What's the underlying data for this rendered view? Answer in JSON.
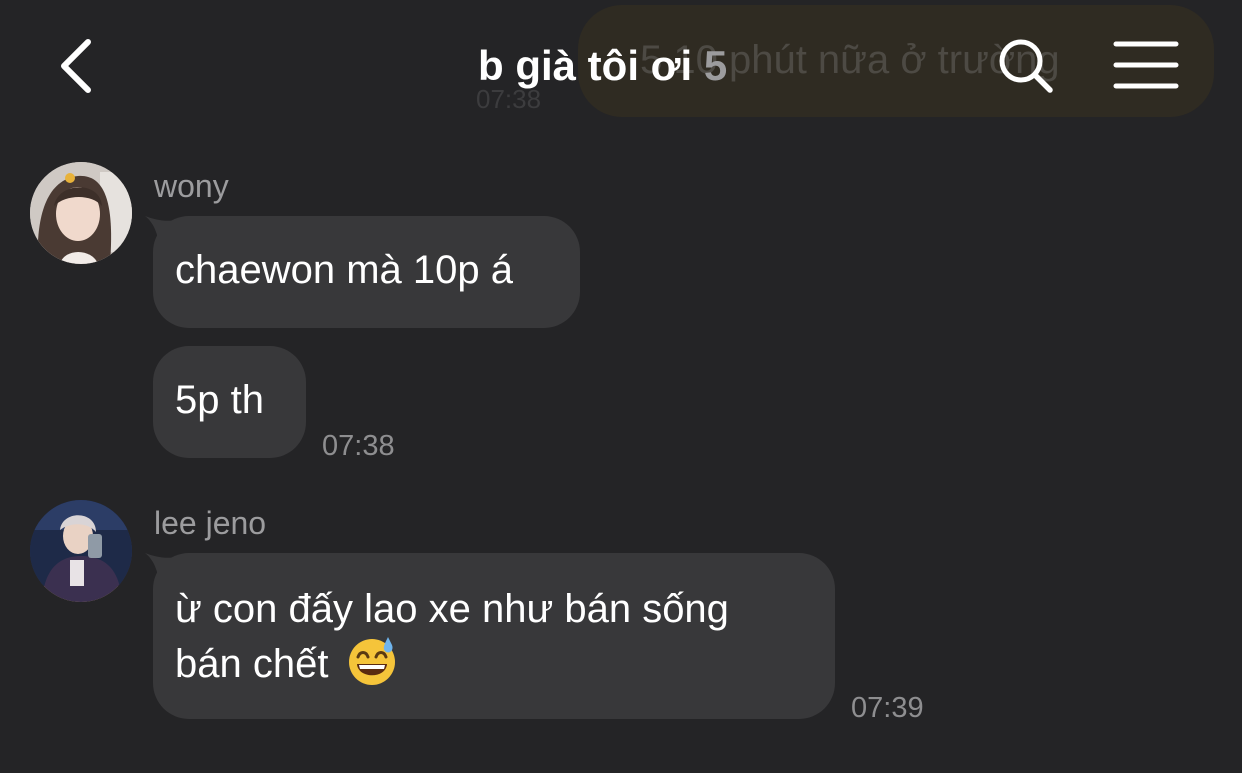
{
  "header": {
    "title": "b già tôi ơi",
    "member_count": "5",
    "back_icon": "chevron-left-icon",
    "search_icon": "search-icon",
    "menu_icon": "hamburger-menu-icon"
  },
  "ghost_message": {
    "text": "5 10 phút nữa ở trường",
    "time": "07:38"
  },
  "messages": [
    {
      "sender": "wony",
      "avatar_icon": "avatar",
      "bubbles": [
        {
          "text": "chaewon mà 10p á"
        },
        {
          "text": "5p th",
          "time": "07:38"
        }
      ]
    },
    {
      "sender": "lee jeno",
      "avatar_icon": "avatar",
      "bubbles": [
        {
          "line1": "ừ con đấy lao xe như bán sống",
          "line2": "bán chết",
          "emoji": "grinning-sweat-emoji",
          "time": "07:39"
        }
      ]
    }
  ],
  "colors": {
    "background": "#242426",
    "bubble": "#38383a",
    "secondary_text": "#9c9c9e"
  }
}
